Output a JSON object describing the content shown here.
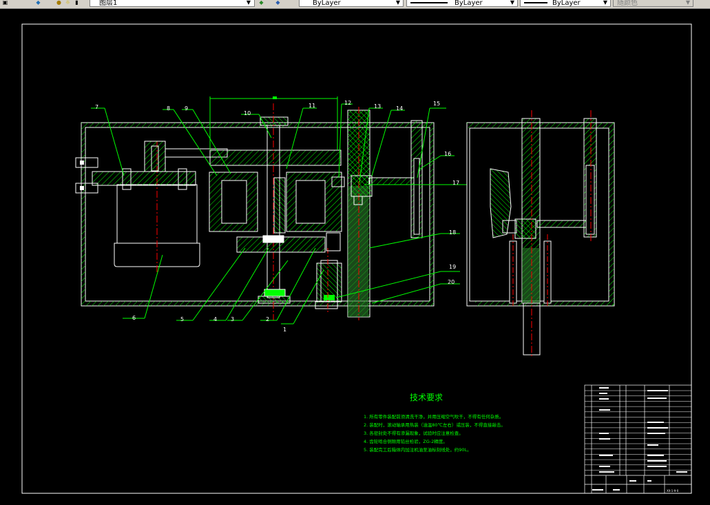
{
  "toolbar": {
    "layer_name": "图层1",
    "color_value": "ByLayer",
    "linetype_value": "ByLayer",
    "lineweight_value": "ByLayer",
    "plotstyle_value": "随颜色"
  },
  "drawing": {
    "part_numbers": [
      "1",
      "2",
      "3",
      "4",
      "5",
      "6",
      "7",
      "8",
      "9",
      "10",
      "11",
      "12",
      "13",
      "14",
      "15",
      "16",
      "17",
      "18",
      "19",
      "20"
    ],
    "tech_title": "技术要求",
    "tech_notes": [
      "1. 所有零件装配前须清洗干净，并用压缩空气吹干，不得有任何杂质。",
      "2. 装配时，滚动轴承用热装（油温80℃左右）或压装，不得直接敲击。",
      "3. 各密封处不得有渗漏现象，试验时应注意检查。",
      "4. 齿轮啮合侧隙用铅丝检验，ZG-2精度。",
      "5. 装配完工后箱体内加注机油至油标刻线处，约90L。"
    ],
    "title_block": {
      "project": "XX-1-9-0"
    }
  }
}
